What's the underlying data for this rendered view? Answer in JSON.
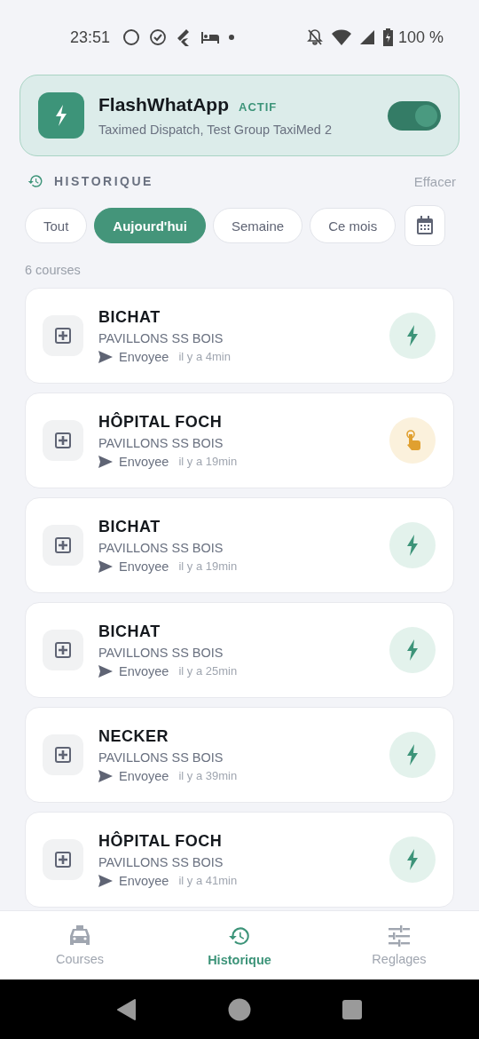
{
  "status_bar": {
    "time": "23:51",
    "battery": "100 %"
  },
  "app_card": {
    "name": "FlashWhatApp",
    "badge": "ACTIF",
    "groups": "Taximed Dispatch, Test Group TaxiMed 2",
    "on": true
  },
  "section": {
    "title": "HISTORIQUE",
    "action": "Effacer"
  },
  "filters": [
    {
      "label": "Tout",
      "selected": false
    },
    {
      "label": "Aujourd'hui",
      "selected": true
    },
    {
      "label": "Semaine",
      "selected": false
    },
    {
      "label": "Ce mois",
      "selected": false
    }
  ],
  "count": "6 courses",
  "rides": [
    {
      "destination": "BICHAT",
      "origin": "PAVILLONS SS BOIS",
      "status": "Envoyee",
      "time": "il y a 4min",
      "kind": "auto"
    },
    {
      "destination": "HÔPITAL FOCH",
      "origin": "PAVILLONS SS BOIS",
      "status": "Envoyee",
      "time": "il y a 19min",
      "kind": "manual"
    },
    {
      "destination": "BICHAT",
      "origin": "PAVILLONS SS BOIS",
      "status": "Envoyee",
      "time": "il y a 19min",
      "kind": "auto"
    },
    {
      "destination": "BICHAT",
      "origin": "PAVILLONS SS BOIS",
      "status": "Envoyee",
      "time": "il y a 25min",
      "kind": "auto"
    },
    {
      "destination": "NECKER",
      "origin": "PAVILLONS SS BOIS",
      "status": "Envoyee",
      "time": "il y a 39min",
      "kind": "auto"
    },
    {
      "destination": "HÔPITAL FOCH",
      "origin": "PAVILLONS SS BOIS",
      "status": "Envoyee",
      "time": "il y a 41min",
      "kind": "auto"
    }
  ],
  "bottom_nav": [
    {
      "label": "Courses",
      "kind": "taxi",
      "selected": false
    },
    {
      "label": "Historique",
      "kind": "history",
      "selected": true
    },
    {
      "label": "Reglages",
      "kind": "sliders",
      "selected": false
    }
  ]
}
